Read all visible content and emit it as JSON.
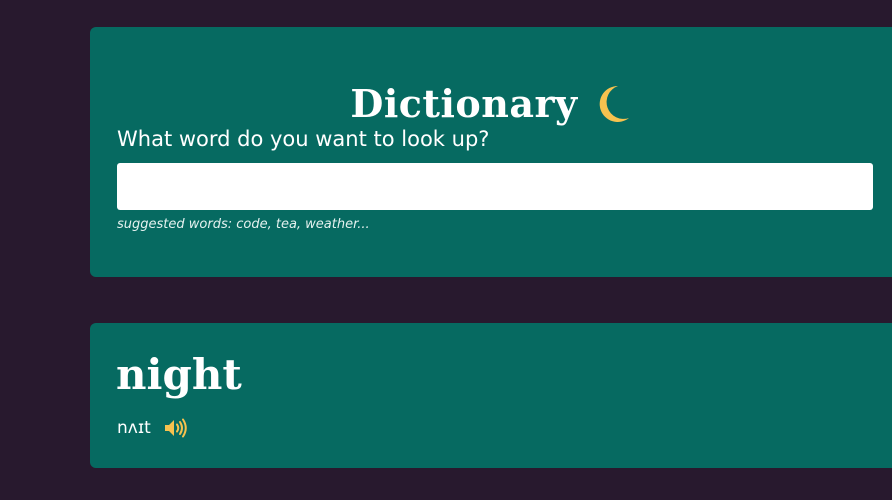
{
  "header": {
    "title": "Dictionary",
    "title_icon": "moon-icon"
  },
  "search": {
    "prompt": "What word do you want to look up?",
    "value": "",
    "placeholder": "",
    "suggestions": "suggested words: code, tea, weather..."
  },
  "result": {
    "word": "night",
    "phonetic": "nʌɪt",
    "audio_icon": "speaker-icon"
  },
  "colors": {
    "background": "#28192e",
    "card": "#066a61",
    "accent": "#f6c24f",
    "text": "#ffffff"
  }
}
